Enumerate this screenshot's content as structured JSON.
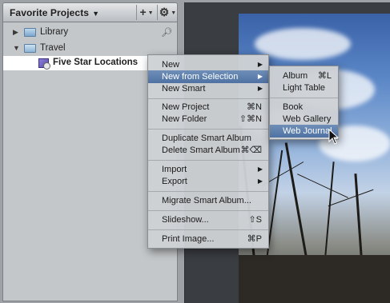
{
  "sidebar": {
    "title": "Favorite Projects",
    "add_button": "+",
    "action_button": "⚙",
    "items": [
      {
        "label": "Library"
      },
      {
        "label": "Travel"
      },
      {
        "label": "Five Star Locations"
      }
    ]
  },
  "context_menu": {
    "items": [
      {
        "label": "New",
        "shortcut": "",
        "submenu": true
      },
      {
        "label": "New from Selection",
        "shortcut": "",
        "submenu": true
      },
      {
        "label": "New Smart",
        "shortcut": "",
        "submenu": true
      },
      {
        "label": "New Project",
        "shortcut": "⌘N",
        "submenu": false
      },
      {
        "label": "New Folder",
        "shortcut": "⇧⌘N",
        "submenu": false
      },
      {
        "label": "Duplicate Smart Album",
        "shortcut": "",
        "submenu": false
      },
      {
        "label": "Delete Smart Album",
        "shortcut": "⌘⌫",
        "submenu": false
      },
      {
        "label": "Import",
        "shortcut": "",
        "submenu": true
      },
      {
        "label": "Export",
        "shortcut": "",
        "submenu": true
      },
      {
        "label": "Migrate Smart Album...",
        "shortcut": "",
        "submenu": false
      },
      {
        "label": "Slideshow...",
        "shortcut": "⇧S",
        "submenu": false
      },
      {
        "label": "Print Image...",
        "shortcut": "⌘P",
        "submenu": false
      }
    ]
  },
  "submenu": {
    "items": [
      {
        "label": "Album",
        "shortcut": "⌘L"
      },
      {
        "label": "Light Table",
        "shortcut": ""
      },
      {
        "label": "Book",
        "shortcut": ""
      },
      {
        "label": "Web Gallery",
        "shortcut": ""
      },
      {
        "label": "Web Journal",
        "shortcut": ""
      }
    ]
  },
  "colors": {
    "highlight": "#5a7bab",
    "panel": "#c4c7ca",
    "selected_row": "#ffffff"
  }
}
